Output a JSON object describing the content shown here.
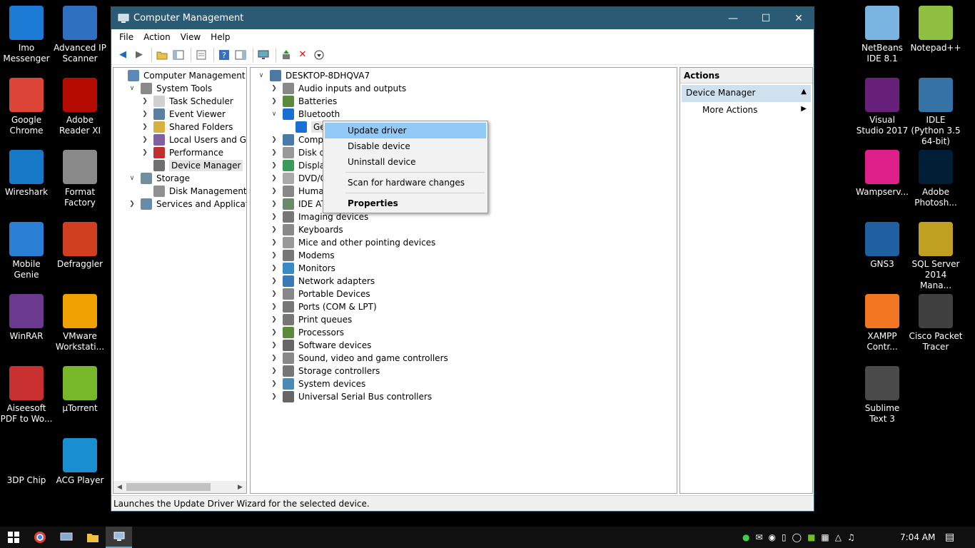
{
  "desktop_left": [
    {
      "label": "Imo Messenger",
      "icon": "imo-icon",
      "color": "#1a7ad4",
      "x": 0,
      "y": 0
    },
    {
      "label": "Advanced IP Scanner",
      "icon": "ip-scanner-icon",
      "color": "#3070c0"
    },
    {
      "label": "Google Chrome",
      "icon": "chrome-icon",
      "color": "#db4437"
    },
    {
      "label": "Adobe Reader XI",
      "icon": "adobe-reader-icon",
      "color": "#b30b00"
    },
    {
      "label": "Wireshark",
      "icon": "wireshark-icon",
      "color": "#1679c5"
    },
    {
      "label": "Format Factory",
      "icon": "format-factory-icon",
      "color": "#8a8a8a"
    },
    {
      "label": "Mobile Genie",
      "icon": "mobile-genie-icon",
      "color": "#2a7fd4"
    },
    {
      "label": "Defraggler",
      "icon": "defraggler-icon",
      "color": "#d04020"
    },
    {
      "label": "WinRAR",
      "icon": "winrar-icon",
      "color": "#6b3a8e"
    },
    {
      "label": "VMware Workstati...",
      "icon": "vmware-icon",
      "color": "#f0a000"
    },
    {
      "label": "Aiseesoft PDF to Wo...",
      "icon": "pdf-converter-icon",
      "color": "#c83030"
    },
    {
      "label": "µTorrent",
      "icon": "utorrent-icon",
      "color": "#76b82a"
    },
    {
      "label": "3DP Chip",
      "icon": "3dp-chip-icon",
      "color": "#000000"
    },
    {
      "label": "ACG Player",
      "icon": "acg-player-icon",
      "color": "#1a8fd0"
    }
  ],
  "desktop_right": [
    {
      "label": "NetBeans IDE 8.1",
      "icon": "netbeans-icon",
      "color": "#7ab4e0"
    },
    {
      "label": "Notepad++",
      "icon": "notepadpp-icon",
      "color": "#90c040"
    },
    {
      "label": "Visual Studio 2017",
      "icon": "visual-studio-icon",
      "color": "#68217a"
    },
    {
      "label": "IDLE (Python 3.5 64-bit)",
      "icon": "python-idle-icon",
      "color": "#3572a5"
    },
    {
      "label": "Wampserv...",
      "icon": "wampserver-icon",
      "color": "#e0208a"
    },
    {
      "label": "Adobe Photosh...",
      "icon": "photoshop-icon",
      "color": "#001e36"
    },
    {
      "label": "GNS3",
      "icon": "gns3-icon",
      "color": "#2060a0"
    },
    {
      "label": "SQL Server 2014 Mana...",
      "icon": "sql-server-icon",
      "color": "#c0a020"
    },
    {
      "label": "XAMPP Contr...",
      "icon": "xampp-icon",
      "color": "#f37623"
    },
    {
      "label": "Cisco Packet Tracer",
      "icon": "packet-tracer-icon",
      "color": "#404040"
    },
    {
      "label": "Sublime Text 3",
      "icon": "sublime-icon",
      "color": "#4a4a4a"
    }
  ],
  "window": {
    "title": "Computer Management",
    "minimize": "—",
    "maximize": "☐",
    "close": "✕"
  },
  "menu": [
    "File",
    "Action",
    "View",
    "Help"
  ],
  "left_tree": [
    {
      "label": "Computer Management (Local",
      "depth": 0,
      "chev": "",
      "icon": "computer-management-icon"
    },
    {
      "label": "System Tools",
      "depth": 1,
      "chev": "v",
      "icon": "system-tools-icon"
    },
    {
      "label": "Task Scheduler",
      "depth": 2,
      "chev": ">",
      "icon": "task-scheduler-icon"
    },
    {
      "label": "Event Viewer",
      "depth": 2,
      "chev": ">",
      "icon": "event-viewer-icon"
    },
    {
      "label": "Shared Folders",
      "depth": 2,
      "chev": ">",
      "icon": "shared-folders-icon"
    },
    {
      "label": "Local Users and Groups",
      "depth": 2,
      "chev": ">",
      "icon": "users-icon"
    },
    {
      "label": "Performance",
      "depth": 2,
      "chev": ">",
      "icon": "performance-icon"
    },
    {
      "label": "Device Manager",
      "depth": 2,
      "chev": "",
      "icon": "device-manager-icon",
      "selected": true
    },
    {
      "label": "Storage",
      "depth": 1,
      "chev": "v",
      "icon": "storage-icon"
    },
    {
      "label": "Disk Management",
      "depth": 2,
      "chev": "",
      "icon": "disk-management-icon"
    },
    {
      "label": "Services and Applications",
      "depth": 1,
      "chev": ">",
      "icon": "services-icon"
    }
  ],
  "device_tree": [
    {
      "label": "DESKTOP-8DHQVA7",
      "depth": 0,
      "chev": "v",
      "icon": "computer-icon"
    },
    {
      "label": "Audio inputs and outputs",
      "depth": 1,
      "chev": ">",
      "icon": "speaker-icon"
    },
    {
      "label": "Batteries",
      "depth": 1,
      "chev": ">",
      "icon": "battery-icon"
    },
    {
      "label": "Bluetooth",
      "depth": 1,
      "chev": "v",
      "icon": "bluetooth-icon"
    },
    {
      "label": "Ger",
      "depth": 2,
      "chev": "",
      "icon": "bluetooth-icon",
      "selected": true
    },
    {
      "label": "Compu",
      "depth": 1,
      "chev": ">",
      "icon": "computer-icon"
    },
    {
      "label": "Disk dri",
      "depth": 1,
      "chev": ">",
      "icon": "disk-icon"
    },
    {
      "label": "Display",
      "depth": 1,
      "chev": ">",
      "icon": "display-icon"
    },
    {
      "label": "DVD/Cl",
      "depth": 1,
      "chev": ">",
      "icon": "dvd-icon"
    },
    {
      "label": "Human",
      "depth": 1,
      "chev": ">",
      "icon": "hid-icon"
    },
    {
      "label": "IDE ATA",
      "depth": 1,
      "chev": ">",
      "icon": "ide-icon"
    },
    {
      "label": "Imaging devices",
      "depth": 1,
      "chev": ">",
      "icon": "camera-icon"
    },
    {
      "label": "Keyboards",
      "depth": 1,
      "chev": ">",
      "icon": "keyboard-icon"
    },
    {
      "label": "Mice and other pointing devices",
      "depth": 1,
      "chev": ">",
      "icon": "mouse-icon"
    },
    {
      "label": "Modems",
      "depth": 1,
      "chev": ">",
      "icon": "modem-icon"
    },
    {
      "label": "Monitors",
      "depth": 1,
      "chev": ">",
      "icon": "monitor-icon"
    },
    {
      "label": "Network adapters",
      "depth": 1,
      "chev": ">",
      "icon": "network-icon"
    },
    {
      "label": "Portable Devices",
      "depth": 1,
      "chev": ">",
      "icon": "portable-device-icon"
    },
    {
      "label": "Ports (COM & LPT)",
      "depth": 1,
      "chev": ">",
      "icon": "port-icon"
    },
    {
      "label": "Print queues",
      "depth": 1,
      "chev": ">",
      "icon": "printer-icon"
    },
    {
      "label": "Processors",
      "depth": 1,
      "chev": ">",
      "icon": "processor-icon"
    },
    {
      "label": "Software devices",
      "depth": 1,
      "chev": ">",
      "icon": "software-device-icon"
    },
    {
      "label": "Sound, video and game controllers",
      "depth": 1,
      "chev": ">",
      "icon": "sound-icon"
    },
    {
      "label": "Storage controllers",
      "depth": 1,
      "chev": ">",
      "icon": "storage-controller-icon"
    },
    {
      "label": "System devices",
      "depth": 1,
      "chev": ">",
      "icon": "system-device-icon"
    },
    {
      "label": "Universal Serial Bus controllers",
      "depth": 1,
      "chev": ">",
      "icon": "usb-icon"
    }
  ],
  "context_menu": {
    "update": "Update driver",
    "disable": "Disable device",
    "uninstall": "Uninstall device",
    "scan": "Scan for hardware changes",
    "properties": "Properties"
  },
  "actions": {
    "header": "Actions",
    "section": "Device Manager",
    "more": "More Actions"
  },
  "status": "Launches the Update Driver Wizard for the selected device.",
  "tray": {
    "time": "7:04 AM"
  }
}
